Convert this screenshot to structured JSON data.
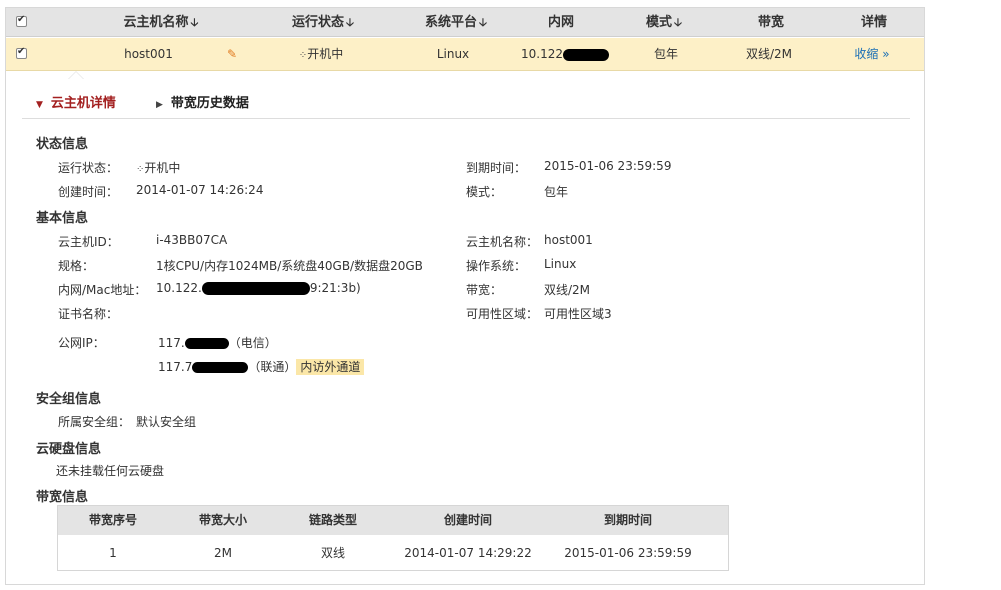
{
  "table": {
    "columns": {
      "name": "云主机名称",
      "status": "运行状态",
      "platform": "系统平台",
      "lan": "内网",
      "mode": "模式",
      "bandwidth": "带宽",
      "detail": "详情"
    },
    "row": {
      "name": "host001",
      "status": "开机中",
      "platform": "Linux",
      "lan_prefix": "10.122",
      "mode": "包年",
      "bandwidth": "双线/2M",
      "collapse": "收缩",
      "collapse_icon": "double-chevron-down-icon"
    }
  },
  "tabs": {
    "detail": "云主机详情",
    "history": "带宽历史数据"
  },
  "status_info": {
    "title": "状态信息",
    "run_status_label": "运行状态：",
    "run_status_value": "开机中",
    "expire_label": "到期时间：",
    "expire_value": "2015-01-06 23:59:59",
    "created_label": "创建时间：",
    "created_value": "2014-01-07 14:26:24",
    "mode_label": "模式：",
    "mode_value": "包年"
  },
  "basic_info": {
    "title": "基本信息",
    "id_label": "云主机ID：",
    "id_value": "i-43BB07CA",
    "name_label": "云主机名称：",
    "name_value": "host001",
    "spec_label": "规格：",
    "spec_value": "1核CPU/内存1024MB/系统盘40GB/数据盘20GB",
    "os_label": "操作系统：",
    "os_value": "Linux",
    "mac_label": "内网/Mac地址：",
    "mac_prefix": "10.122.",
    "mac_suffix": "9:21:3b)",
    "bw_label": "带宽：",
    "bw_value": "双线/2M",
    "cert_label": "证书名称：",
    "zone_label": "可用性区域：",
    "zone_value": "可用性区域3",
    "ip_label": "公网IP：",
    "ip1_prefix": "117.",
    "ip1_isp": "（电信）",
    "ip2_prefix": "117.7",
    "ip2_isp": "（联通）",
    "ip2_tag": "内访外通道"
  },
  "security": {
    "title": "安全组信息",
    "group_label": "所属安全组：",
    "group_value": "默认安全组"
  },
  "disk": {
    "title": "云硬盘信息",
    "empty": "还未挂载任何云硬盘"
  },
  "bandwidth": {
    "title": "带宽信息",
    "headers": [
      "带宽序号",
      "带宽大小",
      "链路类型",
      "创建时间",
      "到期时间"
    ],
    "row": [
      "1",
      "2M",
      "双线",
      "2014-01-07 14:29:22",
      "2015-01-06 23:59:59"
    ]
  },
  "colors": {
    "header_bg": "#e4e4e4",
    "row_highlight": "#fdf0c7",
    "active_tab": "#a32020",
    "link": "#1a6fb5",
    "tag_bg": "#fbe7a8"
  }
}
